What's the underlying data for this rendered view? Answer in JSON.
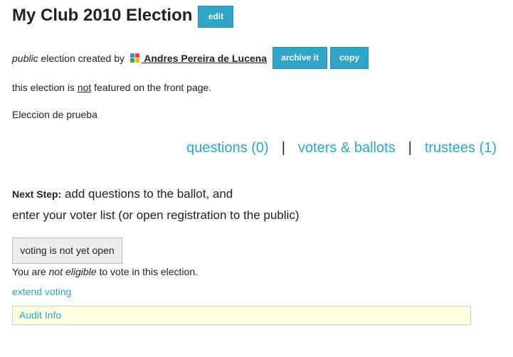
{
  "election": {
    "title": "My Club 2010 Election",
    "edit_label": "edit",
    "visibility": "public",
    "created_by_text": " election created by ",
    "creator_name": " Andres Pereira de Lucena",
    "archive_label": "archive it",
    "copy_label": "copy",
    "featured_prefix": "this election is ",
    "featured_not": "not",
    "featured_suffix": " featured on the front page.",
    "description": "Eleccion de prueba"
  },
  "nav": {
    "questions": "questions (0)",
    "voters": "voters & ballots",
    "trustees": "trustees (1)",
    "separator": "|"
  },
  "next_step": {
    "label": "Next Step:",
    "line1": " add questions to the ballot, and",
    "line2": "enter your voter list (or open registration to the public)"
  },
  "voting": {
    "status_button": "voting is not yet open",
    "eligibility_prefix": "You are ",
    "eligibility_emph": "not eligible",
    "eligibility_suffix": " to vote in this election.",
    "extend_label": "extend voting",
    "audit_label": "Audit Info"
  },
  "colors": {
    "accent": "#2ea5c9",
    "audit_bg": "#ffffe0"
  }
}
